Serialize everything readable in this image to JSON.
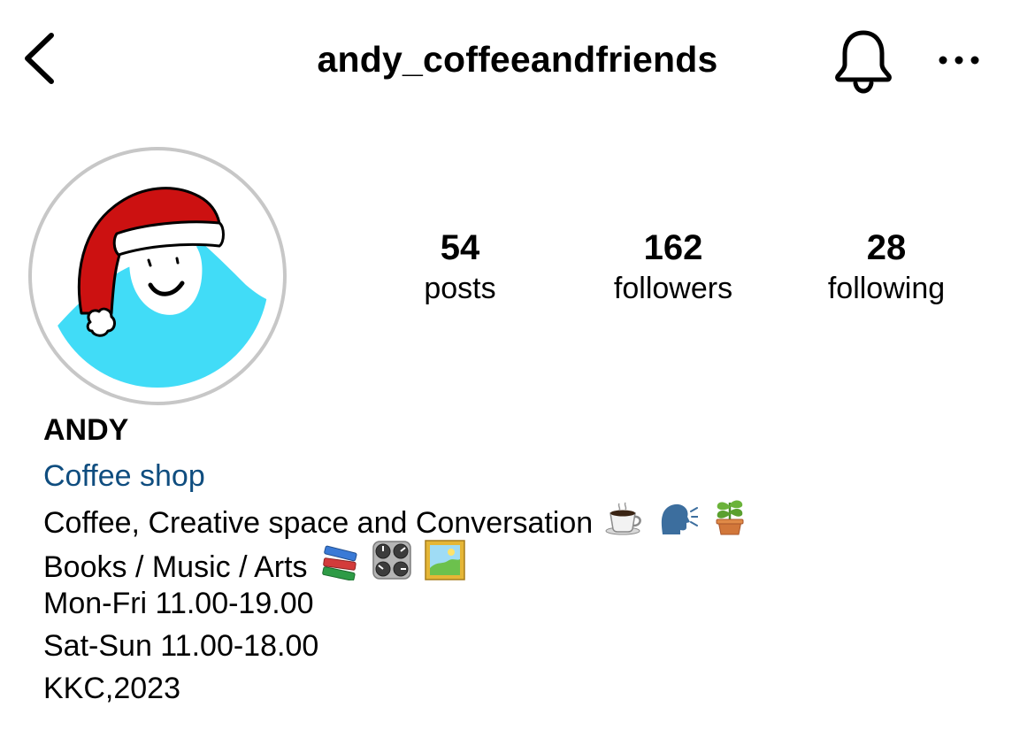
{
  "header": {
    "username": "andy_coffeeandfriends",
    "back_icon": "chevron-left-icon",
    "notification_icon": "bell-icon",
    "more_icon": "more-horizontal-icon"
  },
  "profile": {
    "avatar_icon": "avatar-santa-hat-drawing"
  },
  "stats": [
    {
      "value": "54",
      "label": "posts"
    },
    {
      "value": "162",
      "label": "followers"
    },
    {
      "value": "28",
      "label": "following"
    }
  ],
  "bio": {
    "name": "ANDY",
    "category": "Coffee shop",
    "line1": "Coffee, Creative space and Conversation",
    "line1_emojis": [
      "coffee-cup-icon",
      "speaking-head-icon",
      "potted-plant-icon"
    ],
    "line2": "Books / Music / Arts",
    "line2_emojis": [
      "books-icon",
      "control-knobs-icon",
      "framed-picture-icon"
    ],
    "hours_weekday": "Mon-Fri 11.00-19.00",
    "hours_weekend": "Sat-Sun 11.00-18.00",
    "footer": "KKC,2023"
  },
  "colors": {
    "category_link": "#0f4d7f",
    "avatar_ring": "#c7c7c7",
    "avatar_body": "#41dcf7",
    "santa_hat_red": "#cc1111"
  }
}
